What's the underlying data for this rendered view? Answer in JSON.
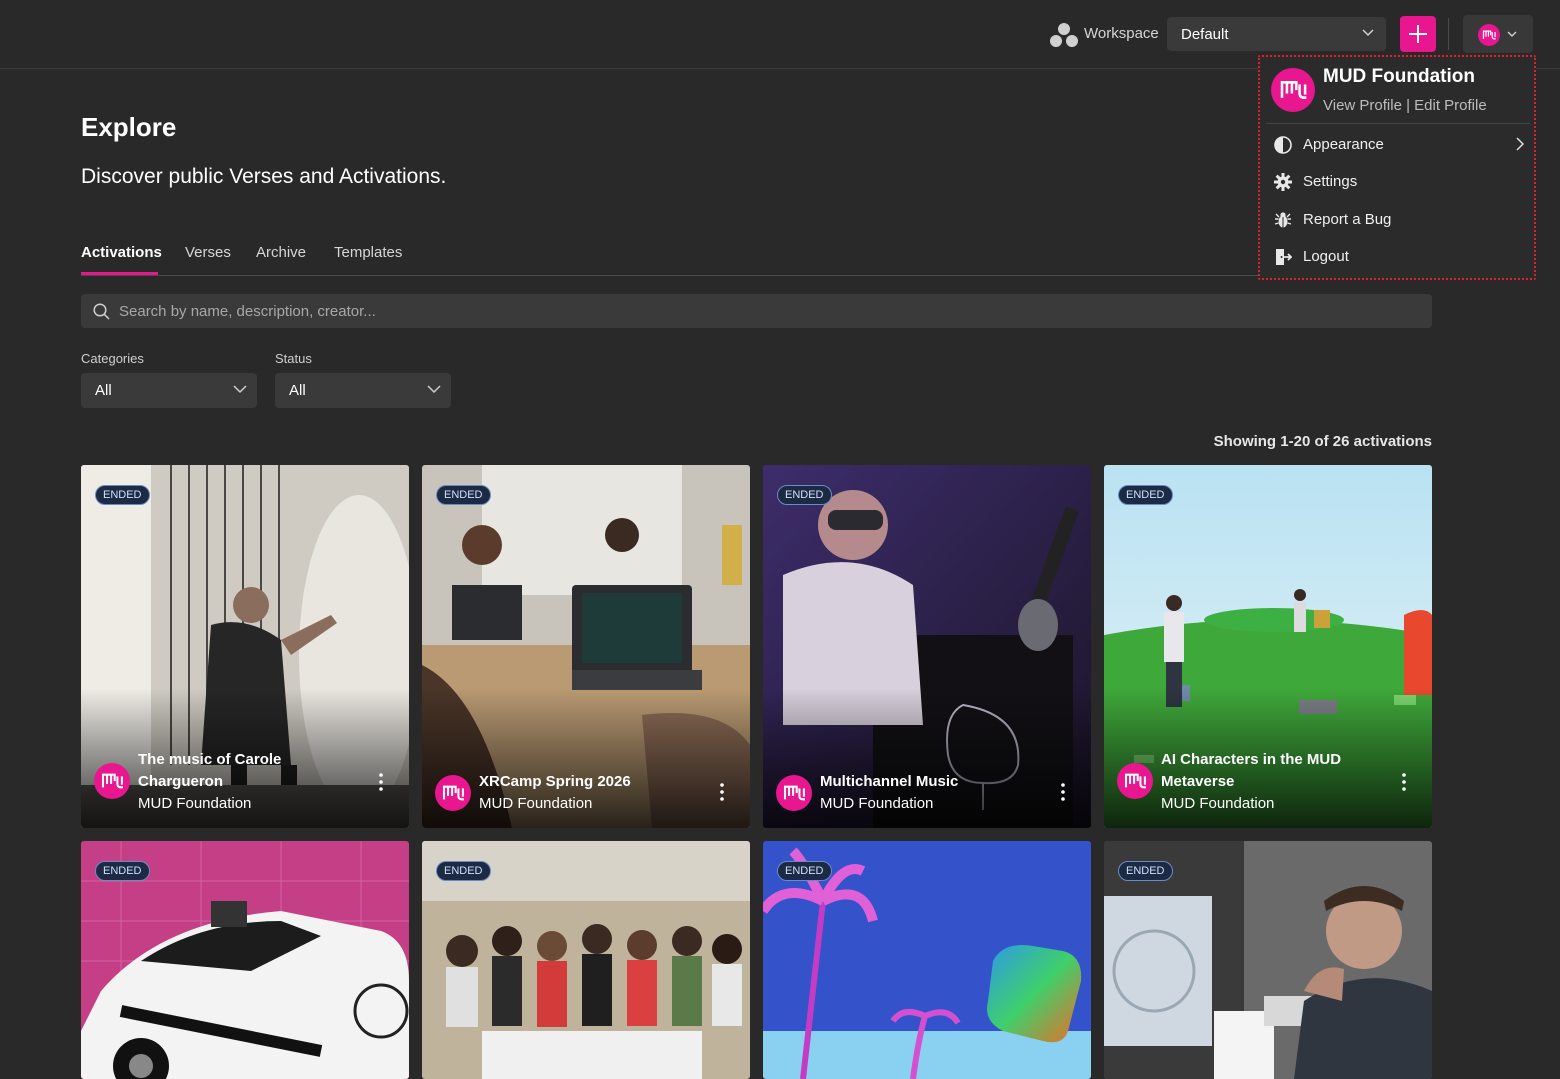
{
  "header": {
    "workspace_label": "Workspace",
    "workspace_value": "Default"
  },
  "profile_menu": {
    "name": "MUD Foundation",
    "links": "View Profile | Edit Profile",
    "items": [
      {
        "label": "Appearance",
        "icon": "contrast-icon"
      },
      {
        "label": "Settings",
        "icon": "gear-icon"
      },
      {
        "label": "Report a Bug",
        "icon": "bug-icon"
      },
      {
        "label": "Logout",
        "icon": "logout-icon"
      }
    ]
  },
  "page": {
    "title": "Explore",
    "subtitle": "Discover public Verses and Activations."
  },
  "tabs": [
    "Activations",
    "Verses",
    "Archive",
    "Templates"
  ],
  "search": {
    "placeholder": "Search by name, description, creator..."
  },
  "filters": {
    "categories_label": "Categories",
    "categories_value": "All",
    "status_label": "Status",
    "status_value": "All"
  },
  "results": {
    "showing": "Showing 1-20 of 26 activations"
  },
  "cards": [
    {
      "badge": "ENDED",
      "title": "The music of Carole Chargueron",
      "org": "MUD Foundation"
    },
    {
      "badge": "ENDED",
      "title": "XRCamp Spring 2026",
      "org": "MUD Foundation"
    },
    {
      "badge": "ENDED",
      "title": "Multichannel Music",
      "org": "MUD Foundation"
    },
    {
      "badge": "ENDED",
      "title": "AI Characters in the MUD Metaverse",
      "org": "MUD Foundation"
    },
    {
      "badge": "ENDED"
    },
    {
      "badge": "ENDED"
    },
    {
      "badge": "ENDED"
    },
    {
      "badge": "ENDED"
    }
  ],
  "colors": {
    "accent": "#e8168f",
    "background": "#292929"
  }
}
